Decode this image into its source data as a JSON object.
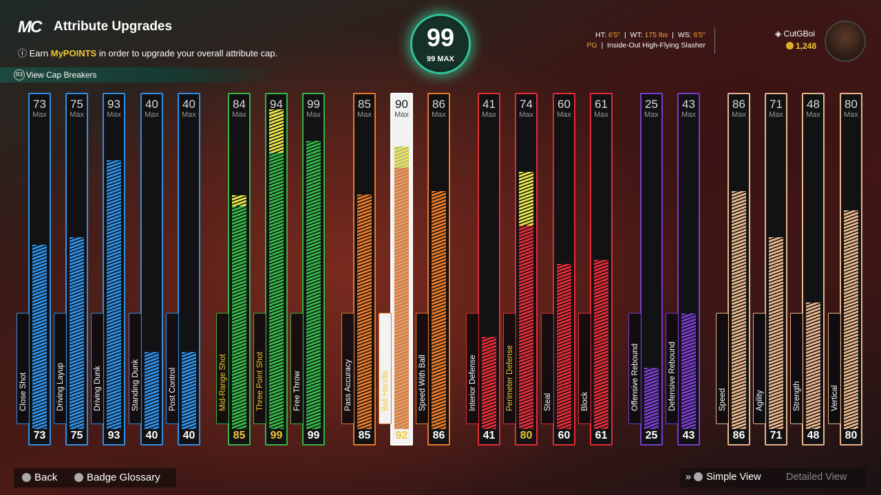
{
  "header": {
    "logo": "MC",
    "title": "Attribute Upgrades",
    "earn_prefix": "Earn",
    "earn_highlight": "MyPOINTS",
    "earn_suffix": "in order to upgrade your overall attribute cap.",
    "cap_breakers": "View Cap Breakers"
  },
  "overall": {
    "value": "99",
    "label": "99 MAX"
  },
  "player": {
    "ht_label": "HT:",
    "ht": "6'5\"",
    "wt_label": "WT:",
    "wt": "175 lbs",
    "ws_label": "WS:",
    "ws": "6'5\"",
    "position": "PG",
    "archetype": "Inside-Out High-Flying Slasher"
  },
  "user": {
    "name": "CutGBoi",
    "currency": "1,248"
  },
  "attributes": [
    {
      "name": "Close Shot",
      "max": "73",
      "current": "73",
      "color": "#2f8fe6",
      "group": "blue",
      "level": 0.32
    },
    {
      "name": "Driving Layup",
      "max": "75",
      "current": "75",
      "color": "#2f8fe6",
      "group": "blue",
      "level": 0.34
    },
    {
      "name": "Driving Dunk",
      "max": "93",
      "current": "93",
      "color": "#2f8fe6",
      "group": "blue",
      "level": 0.54
    },
    {
      "name": "Standing Dunk",
      "max": "40",
      "current": "40",
      "color": "#2f8fe6",
      "group": "blue",
      "level": 0.04
    },
    {
      "name": "Post Control",
      "max": "40",
      "current": "40",
      "color": "#2f8fe6",
      "group": "blue",
      "level": 0.04
    },
    {
      "name": "Mid-Range Shot",
      "max": "84",
      "current": "85",
      "color": "#35b547",
      "group": "green",
      "level": 0.42,
      "boost": 0.01
    },
    {
      "name": "Three Point Shot",
      "max": "94",
      "current": "99",
      "color": "#35b547",
      "group": "green",
      "level": 0.56,
      "boost": 0.04
    },
    {
      "name": "Free Throw",
      "max": "99",
      "current": "99",
      "color": "#35b547",
      "group": "green",
      "level": 0.59
    },
    {
      "name": "Pass Accuracy",
      "max": "85",
      "current": "85",
      "color": "#e97a2a",
      "group": "orange",
      "level": 0.45
    },
    {
      "name": "Ball Handle",
      "max": "90",
      "current": "92",
      "color": "#e97a2a",
      "group": "orange",
      "level": 0.52,
      "boost": 0.02,
      "selected": true
    },
    {
      "name": "Speed With Ball",
      "max": "86",
      "current": "86",
      "color": "#e97a2a",
      "group": "orange",
      "level": 0.46
    },
    {
      "name": "Interior Defense",
      "max": "41",
      "current": "41",
      "color": "#e22c38",
      "group": "red",
      "level": 0.08
    },
    {
      "name": "Perimeter Defense",
      "max": "74",
      "current": "80",
      "color": "#e22c38",
      "group": "red",
      "level": 0.37,
      "boost": 0.05
    },
    {
      "name": "Steal",
      "max": "60",
      "current": "60",
      "color": "#e22c38",
      "group": "red",
      "level": 0.27
    },
    {
      "name": "Block",
      "max": "61",
      "current": "61",
      "color": "#e22c38",
      "group": "red",
      "level": 0.28
    },
    {
      "name": "Offensive Rebound",
      "max": "25",
      "current": "25",
      "color": "#7a3ccf",
      "group": "purple",
      "level": 0.0
    },
    {
      "name": "Defensive Rebound",
      "max": "43",
      "current": "43",
      "color": "#7a3ccf",
      "group": "purple",
      "level": 0.14
    },
    {
      "name": "Speed",
      "max": "86",
      "current": "86",
      "color": "#e9b58c",
      "group": "tan",
      "level": 0.46
    },
    {
      "name": "Agility",
      "max": "71",
      "current": "71",
      "color": "#e9b58c",
      "group": "tan",
      "level": 0.34
    },
    {
      "name": "Strength",
      "max": "48",
      "current": "48",
      "color": "#e9b58c",
      "group": "tan",
      "level": 0.17
    },
    {
      "name": "Vertical",
      "max": "80",
      "current": "80",
      "color": "#e9b58c",
      "group": "tan",
      "level": 0.41
    }
  ],
  "max_label": "Max",
  "footer": {
    "back": "Back",
    "glossary": "Badge Glossary"
  },
  "views": {
    "simple": "Simple View",
    "detailed": "Detailed View"
  }
}
